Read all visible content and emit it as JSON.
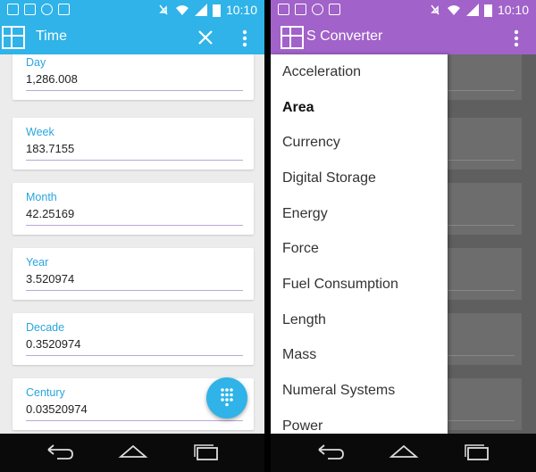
{
  "status_bar": {
    "time": "10:10"
  },
  "left_app": {
    "title": "Time",
    "accent": "#2fb3e8",
    "fields": [
      {
        "label": "Day",
        "value": "1,286.008"
      },
      {
        "label": "Week",
        "value": "183.7155"
      },
      {
        "label": "Month",
        "value": "42.25169"
      },
      {
        "label": "Year",
        "value": "3.520974"
      },
      {
        "label": "Decade",
        "value": "0.3520974"
      },
      {
        "label": "Century",
        "value": "0.03520974"
      }
    ],
    "fab_icon": "dialpad-icon"
  },
  "right_app": {
    "title": "S Converter",
    "accent": "#a162c9",
    "menu": [
      {
        "label": "Acceleration"
      },
      {
        "label": "Area",
        "selected": true
      },
      {
        "label": "Currency"
      },
      {
        "label": "Digital Storage"
      },
      {
        "label": "Energy"
      },
      {
        "label": "Force"
      },
      {
        "label": "Fuel Consumption"
      },
      {
        "label": "Length"
      },
      {
        "label": "Mass"
      },
      {
        "label": "Numeral Systems"
      },
      {
        "label": "Power"
      }
    ]
  }
}
